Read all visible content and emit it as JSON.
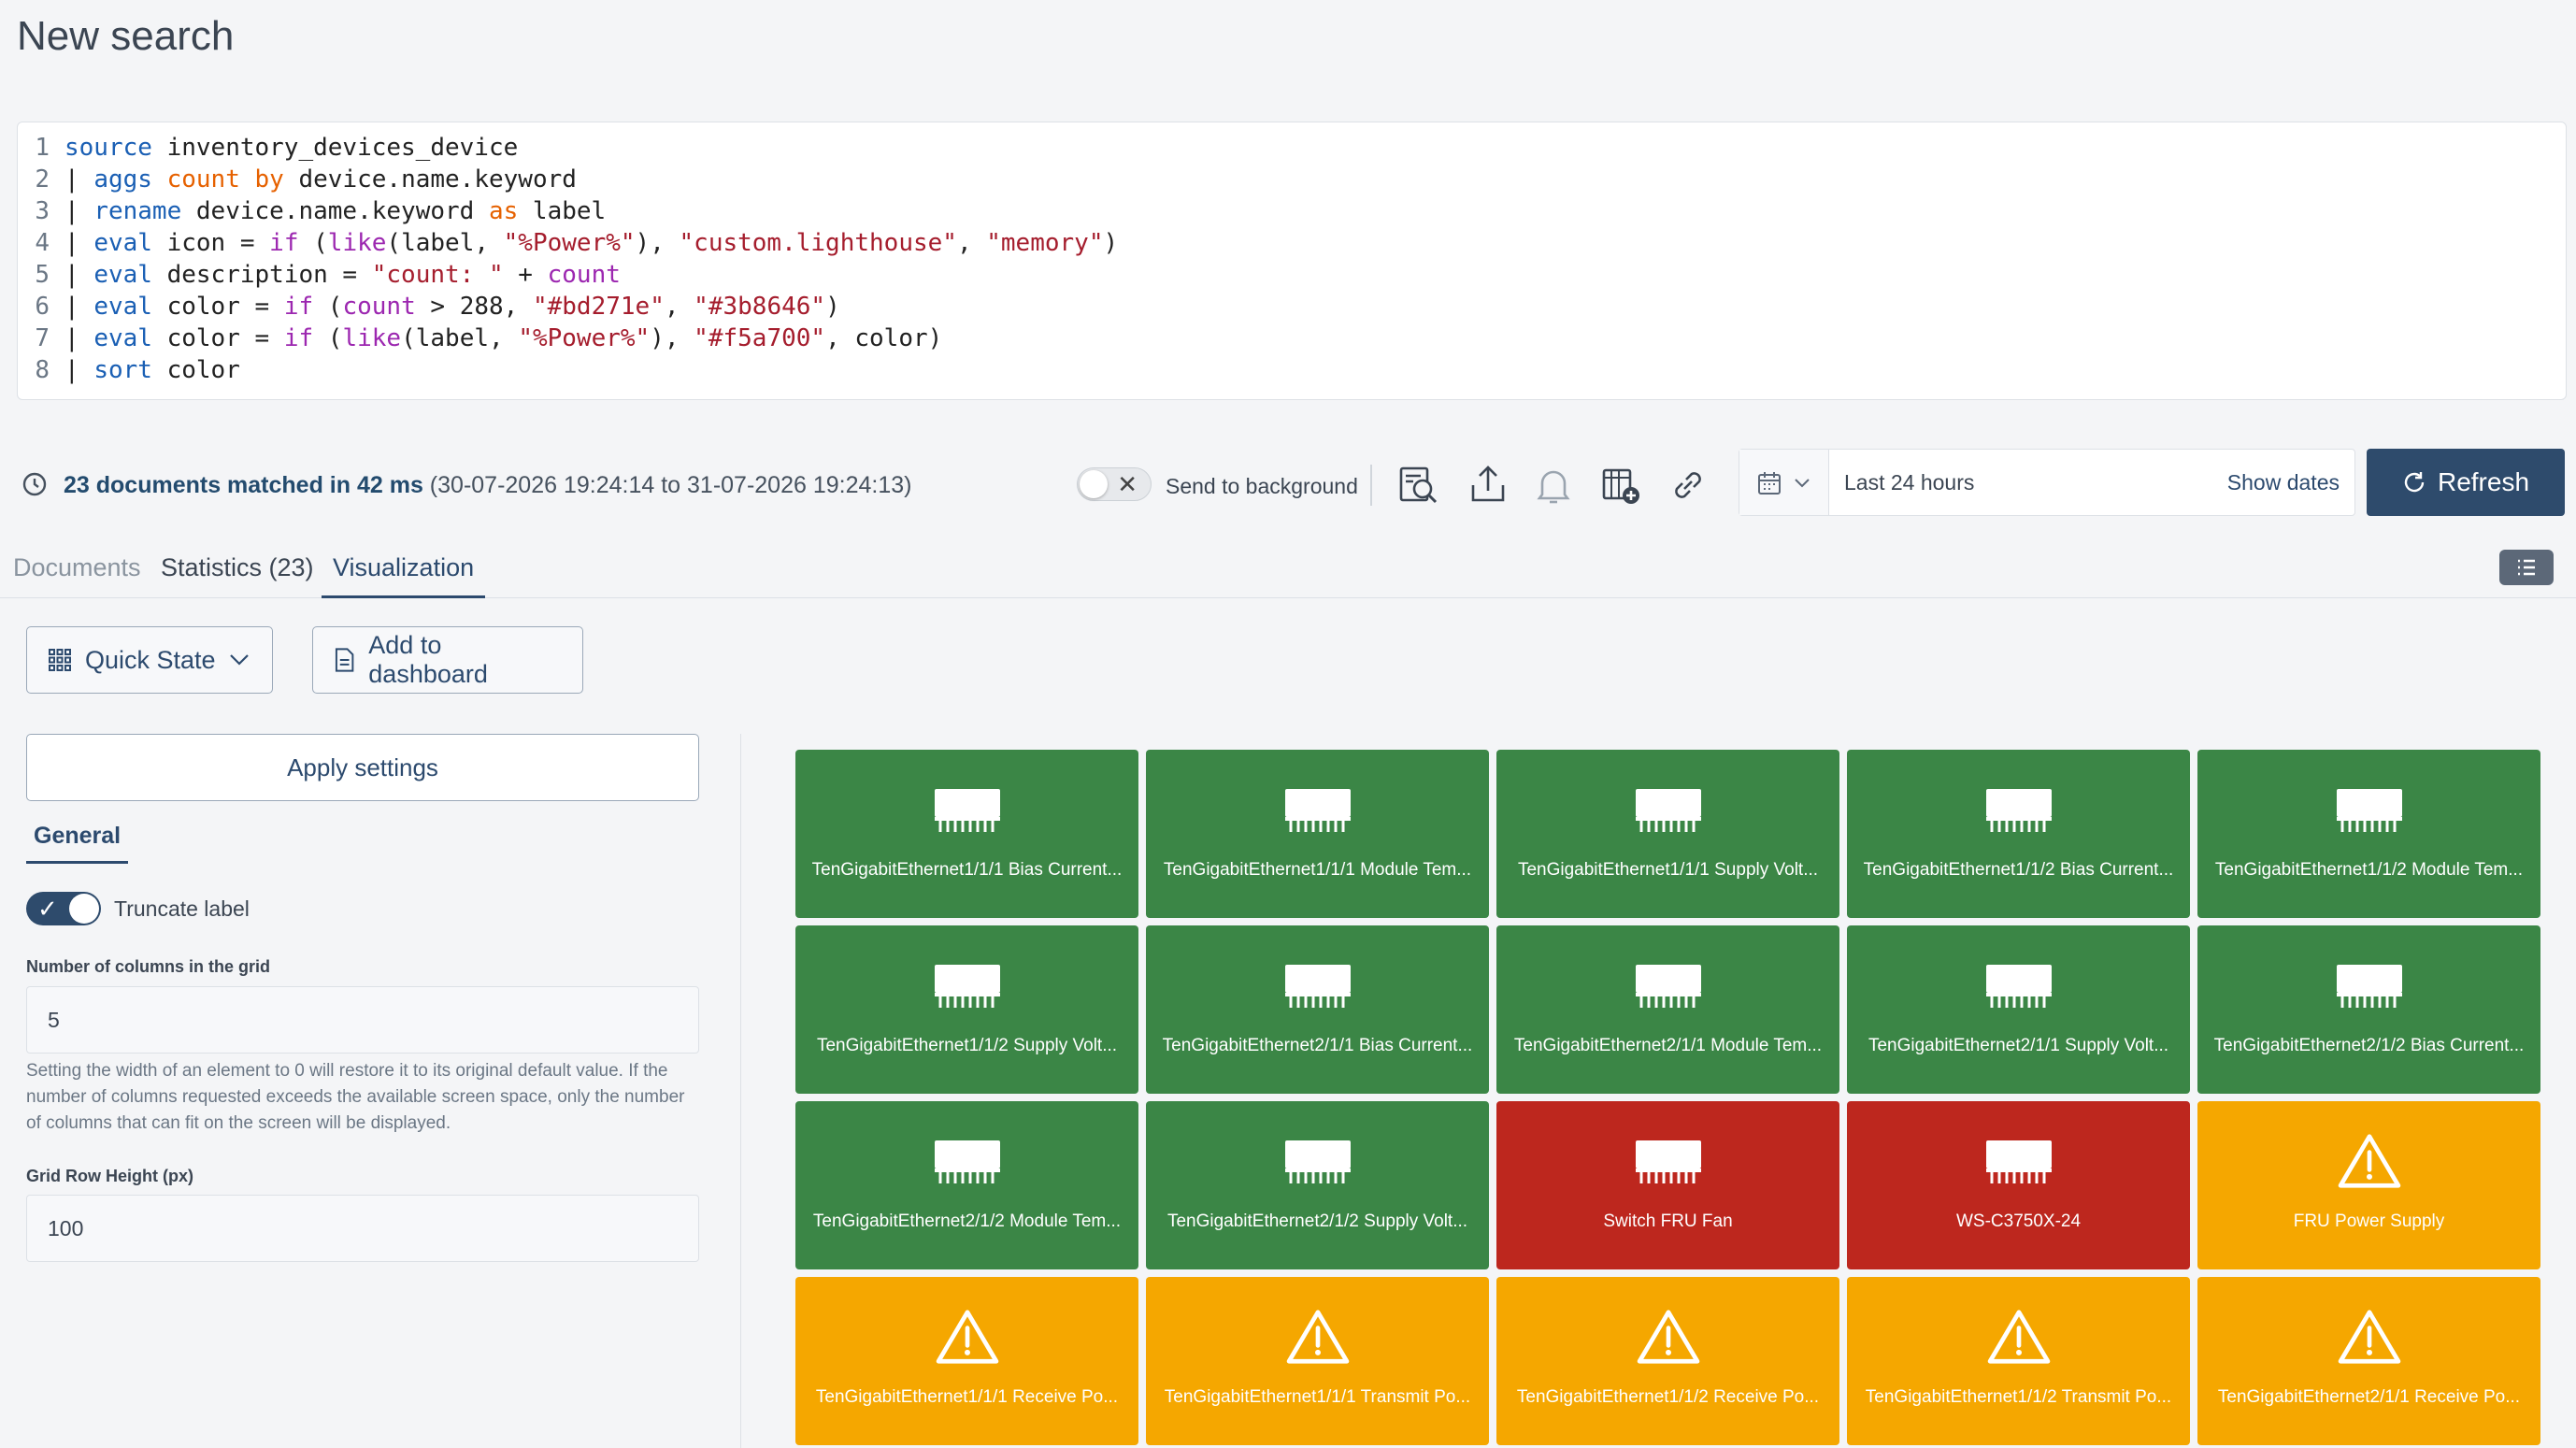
{
  "page": {
    "title": "New search"
  },
  "query_lines": [
    {
      "n": "1"
    },
    {
      "n": "2"
    },
    {
      "n": "3"
    },
    {
      "n": "4"
    },
    {
      "n": "5"
    },
    {
      "n": "6"
    },
    {
      "n": "7"
    },
    {
      "n": "8"
    }
  ],
  "query": {
    "l1": {
      "a": "source",
      "b": " inventory_devices_device"
    },
    "l2": {
      "pipe": "| ",
      "a": "aggs",
      "b": " ",
      "c": "count",
      "d": " ",
      "e": "by",
      "f": " device.name.keyword"
    },
    "l3": {
      "pipe": "| ",
      "a": "rename",
      "b": " device.name.keyword ",
      "c": "as",
      "d": " label"
    },
    "l4": {
      "pipe": "| ",
      "a": "eval",
      "b": " icon = ",
      "c": "if",
      "d": " (",
      "e": "like",
      "f": "(label, ",
      "g": "\"%Power%\"",
      "h": "), ",
      "i": "\"custom.lighthouse\"",
      "j": ", ",
      "k": "\"memory\"",
      "l": ")"
    },
    "l5": {
      "pipe": "| ",
      "a": "eval",
      "b": " description = ",
      "c": "\"count: \"",
      "d": " + ",
      "e": "count"
    },
    "l6": {
      "pipe": "| ",
      "a": "eval",
      "b": " color = ",
      "c": "if",
      "d": " (",
      "e": "count",
      "f": " > 288, ",
      "g": "\"#bd271e\"",
      "h": ", ",
      "i": "\"#3b8646\"",
      "j": ")"
    },
    "l7": {
      "pipe": "| ",
      "a": "eval",
      "b": " color = ",
      "c": "if",
      "d": " (",
      "e": "like",
      "f": "(label, ",
      "g": "\"%Power%\"",
      "h": "), ",
      "i": "\"#f5a700\"",
      "j": ", color)"
    },
    "l8": {
      "pipe": "| ",
      "a": "sort",
      "b": " color"
    }
  },
  "status": {
    "matched": "23 documents matched in 42 ms",
    "range": " (30-07-2026 19:24:14 to 31-07-2026 19:24:13)",
    "send_bg": "Send to background",
    "time_range": "Last 24 hours",
    "show_dates": "Show dates",
    "refresh": "Refresh"
  },
  "tabs": {
    "documents": "Documents",
    "statistics": "Statistics (23)",
    "visualization": "Visualization"
  },
  "panel": {
    "quick_state": "Quick State",
    "add_dashboard": "Add to dashboard",
    "apply": "Apply settings",
    "general": "General",
    "truncate": "Truncate label",
    "columns_label": "Number of columns in the grid",
    "columns_value": "5",
    "help": "Setting the width of an element to 0 will restore it to its original default value. If the number of columns requested exceeds the available screen space, only the number of columns that can fit on the screen will be displayed.",
    "row_height_label": "Grid Row Height (px)",
    "row_height_value": "100"
  },
  "colors": {
    "green": "#3b8646",
    "red": "#bd271e",
    "orange": "#f5a700"
  },
  "tiles": [
    {
      "label": "TenGigabitEthernet1/1/1 Bias Current...",
      "color": "#3b8646",
      "icon": "memory"
    },
    {
      "label": "TenGigabitEthernet1/1/1 Module Tem...",
      "color": "#3b8646",
      "icon": "memory"
    },
    {
      "label": "TenGigabitEthernet1/1/1 Supply Volt...",
      "color": "#3b8646",
      "icon": "memory"
    },
    {
      "label": "TenGigabitEthernet1/1/2 Bias Current...",
      "color": "#3b8646",
      "icon": "memory"
    },
    {
      "label": "TenGigabitEthernet1/1/2 Module Tem...",
      "color": "#3b8646",
      "icon": "memory"
    },
    {
      "label": "TenGigabitEthernet1/1/2 Supply Volt...",
      "color": "#3b8646",
      "icon": "memory"
    },
    {
      "label": "TenGigabitEthernet2/1/1 Bias Current...",
      "color": "#3b8646",
      "icon": "memory"
    },
    {
      "label": "TenGigabitEthernet2/1/1 Module Tem...",
      "color": "#3b8646",
      "icon": "memory"
    },
    {
      "label": "TenGigabitEthernet2/1/1 Supply Volt...",
      "color": "#3b8646",
      "icon": "memory"
    },
    {
      "label": "TenGigabitEthernet2/1/2 Bias Current...",
      "color": "#3b8646",
      "icon": "memory"
    },
    {
      "label": "TenGigabitEthernet2/1/2 Module Tem...",
      "color": "#3b8646",
      "icon": "memory"
    },
    {
      "label": "TenGigabitEthernet2/1/2 Supply Volt...",
      "color": "#3b8646",
      "icon": "memory"
    },
    {
      "label": "Switch FRU Fan",
      "color": "#bd271e",
      "icon": "memory"
    },
    {
      "label": "WS-C3750X-24",
      "color": "#bd271e",
      "icon": "memory"
    },
    {
      "label": "FRU Power Supply",
      "color": "#f5a700",
      "icon": "warning"
    },
    {
      "label": "TenGigabitEthernet1/1/1 Receive Po...",
      "color": "#f5a700",
      "icon": "warning"
    },
    {
      "label": "TenGigabitEthernet1/1/1 Transmit Po...",
      "color": "#f5a700",
      "icon": "warning"
    },
    {
      "label": "TenGigabitEthernet1/1/2 Receive Po...",
      "color": "#f5a700",
      "icon": "warning"
    },
    {
      "label": "TenGigabitEthernet1/1/2 Transmit Po...",
      "color": "#f5a700",
      "icon": "warning"
    },
    {
      "label": "TenGigabitEthernet2/1/1 Receive Po...",
      "color": "#f5a700",
      "icon": "warning"
    }
  ]
}
